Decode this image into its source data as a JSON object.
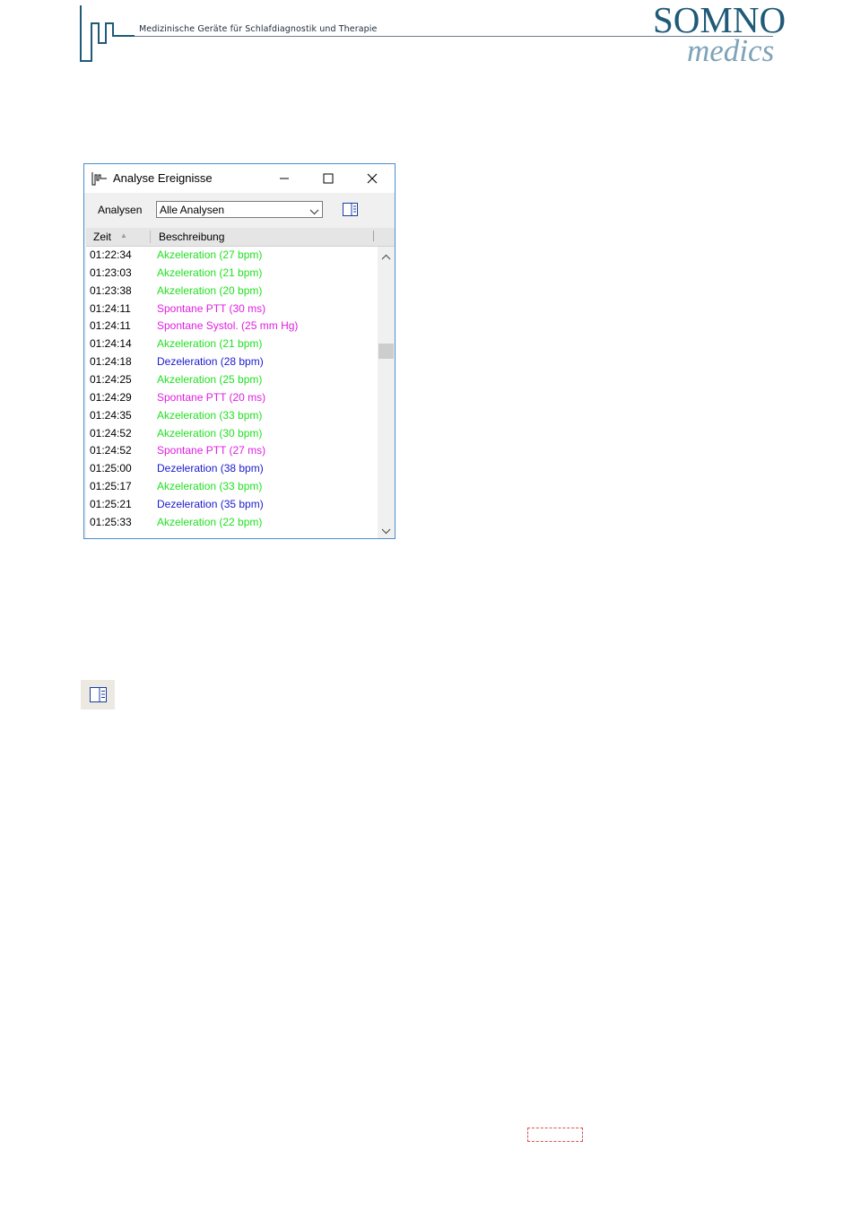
{
  "header": {
    "tagline": "Medizinische Geräte für Schlafdiagnostik und Therapie",
    "logo_line1": "SOMNO",
    "logo_line2": "medics"
  },
  "window": {
    "title": "Analyse Ereignisse",
    "toolbar": {
      "label": "Analysen",
      "selected": "Alle Analysen"
    },
    "columns": [
      "Zeit",
      "Beschreibung"
    ],
    "rows": [
      {
        "time": "01:22:34",
        "desc": "Akzeleration (27 bpm)",
        "color": "#22e022"
      },
      {
        "time": "01:23:03",
        "desc": "Akzeleration (21 bpm)",
        "color": "#22e022"
      },
      {
        "time": "01:23:38",
        "desc": "Akzeleration (20 bpm)",
        "color": "#22e022"
      },
      {
        "time": "01:24:11",
        "desc": "Spontane PTT (30 ms)",
        "color": "#e01ee0"
      },
      {
        "time": "01:24:11",
        "desc": "Spontane Systol. (25 mm Hg)",
        "color": "#e01ee0"
      },
      {
        "time": "01:24:14",
        "desc": "Akzeleration (21 bpm)",
        "color": "#22e022"
      },
      {
        "time": "01:24:18",
        "desc": "Dezeleration (28 bpm)",
        "color": "#1a1acc"
      },
      {
        "time": "01:24:25",
        "desc": "Akzeleration (25 bpm)",
        "color": "#22e022"
      },
      {
        "time": "01:24:29",
        "desc": "Spontane PTT (20 ms)",
        "color": "#e01ee0"
      },
      {
        "time": "01:24:35",
        "desc": "Akzeleration (33 bpm)",
        "color": "#22e022"
      },
      {
        "time": "01:24:52",
        "desc": "Akzeleration (30 bpm)",
        "color": "#22e022"
      },
      {
        "time": "01:24:52",
        "desc": "Spontane PTT (27 ms)",
        "color": "#e01ee0"
      },
      {
        "time": "01:25:00",
        "desc": "Dezeleration (38 bpm)",
        "color": "#1a1acc"
      },
      {
        "time": "01:25:17",
        "desc": "Akzeleration (33 bpm)",
        "color": "#22e022"
      },
      {
        "time": "01:25:21",
        "desc": "Dezeleration (35 bpm)",
        "color": "#1a1acc"
      },
      {
        "time": "01:25:33",
        "desc": "Akzeleration (22 bpm)",
        "color": "#22e022"
      }
    ]
  },
  "colors": {
    "window_border": "#4a8fd0",
    "brand_dark": "#1f5a78",
    "brand_light": "#7da3b8",
    "acceleration": "#22e022",
    "deceleration": "#1a1acc",
    "spontaneous": "#e01ee0"
  }
}
